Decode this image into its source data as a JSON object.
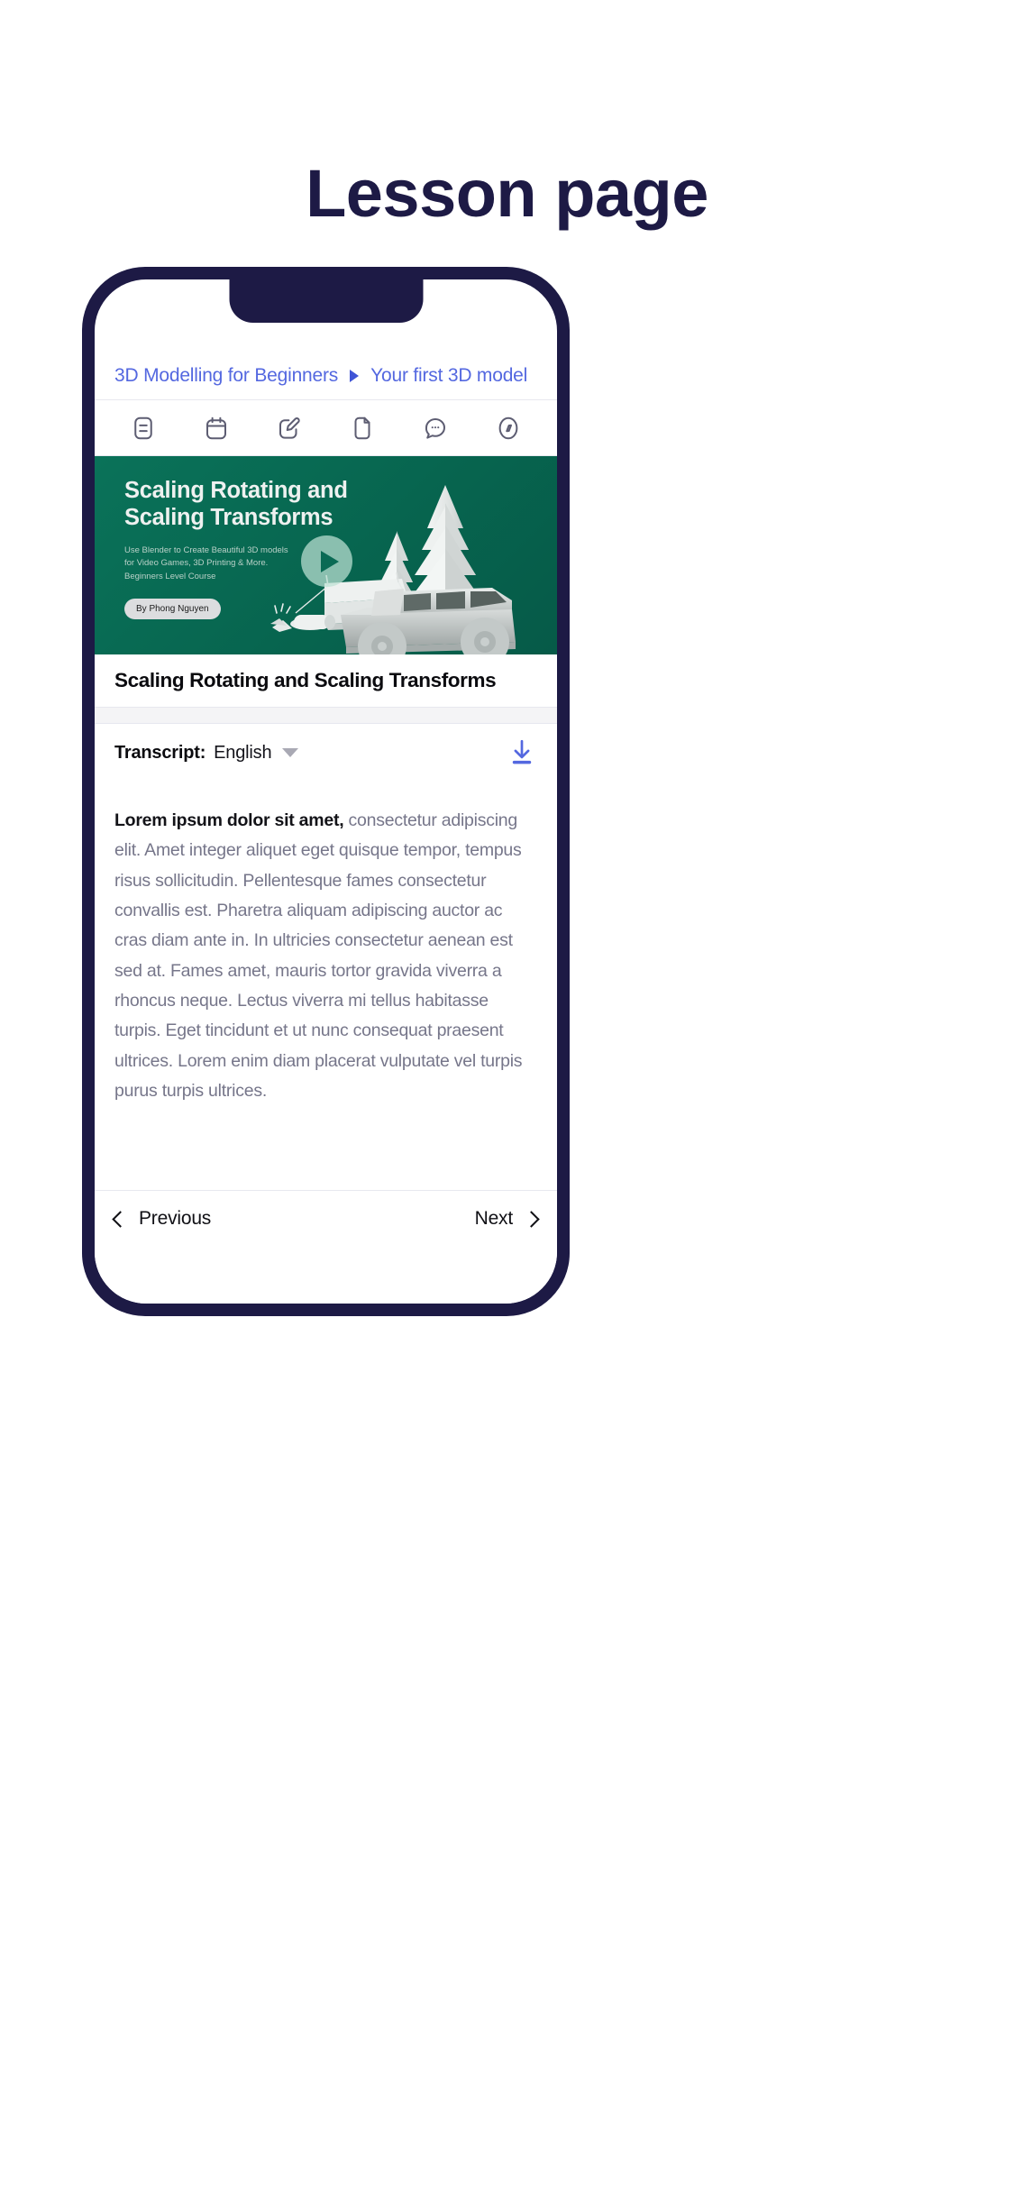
{
  "page": {
    "title": "Lesson page"
  },
  "colors": {
    "navy": "#1d1a45",
    "blue_link": "#5468e0",
    "banner_green": "#07654f",
    "body_gray": "#76768a",
    "strip_gray": "#f4f4f6"
  },
  "breadcrumb": {
    "course": "3D Modelling for Beginners",
    "separator_icon": "triangle-right-icon",
    "section": "Your first 3D model"
  },
  "toolbar": {
    "icons": [
      {
        "name": "list-icon",
        "label": "Overview"
      },
      {
        "name": "calendar-icon",
        "label": "Schedule"
      },
      {
        "name": "edit-icon",
        "label": "Notes"
      },
      {
        "name": "file-icon",
        "label": "Resources"
      },
      {
        "name": "chat-icon",
        "label": "Discussion"
      },
      {
        "name": "compass-icon",
        "label": "Explore"
      }
    ]
  },
  "banner": {
    "title_line1": "Scaling Rotating and",
    "title_line2": "Scaling Transforms",
    "subtitle_line1": "Use Blender to Create Beautiful 3D models",
    "subtitle_line2": "for Video Games, 3D Printing & More.",
    "subtitle_line3": "Beginners Level Course",
    "author_badge": "By Phong Nguyen",
    "play_icon": "play-icon"
  },
  "lesson": {
    "title": "Scaling Rotating and Scaling Transforms"
  },
  "transcript": {
    "label": "Transcript:",
    "language": "English",
    "caret_icon": "chevron-down-icon",
    "download_icon": "download-icon",
    "lead": "Lorem ipsum dolor sit amet,",
    "body": " consectetur adipiscing elit. Amet integer aliquet eget quisque tempor, tempus risus sollicitudin. Pellentesque fames consectetur convallis est. Pharetra aliquam adipiscing auctor ac cras diam ante in. In ultricies consectetur aenean est sed at. Fames amet, mauris tortor gravida viverra a rhoncus neque. Lectus viverra mi tellus habitasse turpis. Eget tincidunt et ut nunc consequat praesent ultrices. Lorem enim diam placerat vulputate vel turpis purus turpis ultrices."
  },
  "bottom_nav": {
    "previous_label": "Previous",
    "previous_icon": "chevron-left-icon",
    "next_label": "Next",
    "next_icon": "chevron-right-icon"
  }
}
